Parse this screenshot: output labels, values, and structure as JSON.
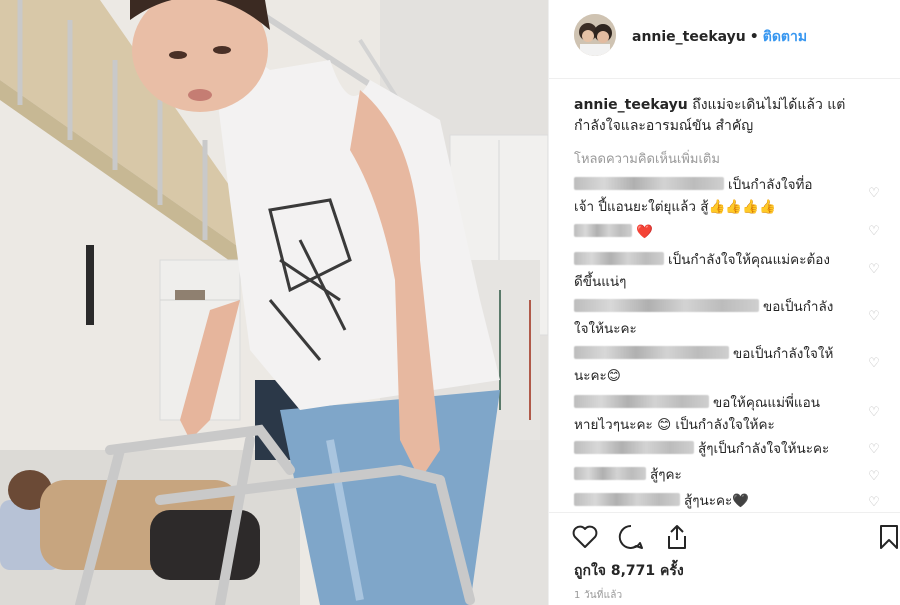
{
  "post": {
    "username": "annie_teekayu",
    "separator": "•",
    "follow_label": "ติดตาม",
    "caption_user": "annie_teekayu",
    "caption_text": "ถึงแม่จะเดินไม่ได้แล้ว แต่กำลังใจและอารมณ์ขัน สำคัญ",
    "load_more": "โหลดความคิดเห็นเพิ่มเติม",
    "likes_text": "ถูกใจ 8,771 ครั้ง",
    "time_text": "1 วันที่แล้ว"
  },
  "comments": [
    {
      "text": "เป็นกำลังใจที่อ",
      "text2": "เจ้า ปี้แอนยะใต่ยุแล้ว สู้👍👍👍👍"
    },
    {
      "text": "❤️",
      "text2": ""
    },
    {
      "text": "เป็นกำลังใจให้คุณแม่คะต้อง",
      "text2": "ดีขึ้นแน่ๆ"
    },
    {
      "text": "ขอเป็นกำลัง",
      "text2": "ใจให้นะคะ"
    },
    {
      "text": "ขอเป็นกำลังใจให้",
      "text2": "นะคะ😊"
    },
    {
      "text": "ขอให้คุณแม่พี่แอน",
      "text2": "หายไวๆนะคะ 😊 เป็นกำลังใจให้คะ"
    },
    {
      "text": "สู้ๆเป็นกำลังใจให้นะคะ",
      "text2": ""
    },
    {
      "text": "สู้ๆคะ",
      "text2": ""
    },
    {
      "text": "สู้ๆนะคะ🖤",
      "text2": ""
    }
  ],
  "icons": {
    "like": "heart-icon",
    "comment": "comment-icon",
    "share": "share-icon",
    "save": "bookmark-icon",
    "comment_like": "small-heart-icon"
  },
  "colors": {
    "link": "#3897f0",
    "text": "#262626",
    "muted": "#999999"
  }
}
